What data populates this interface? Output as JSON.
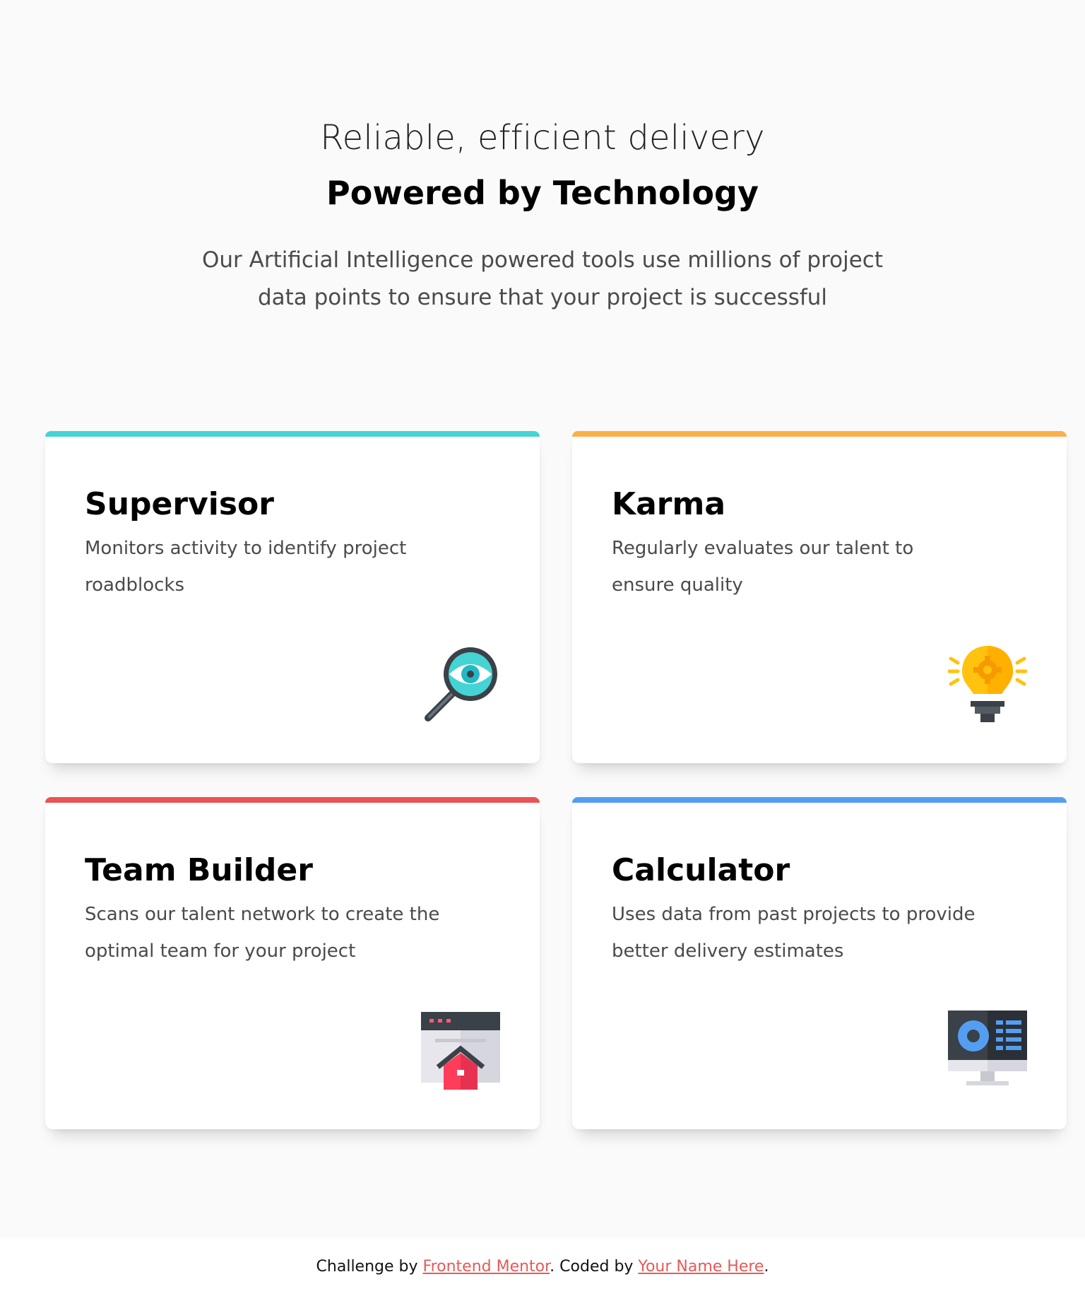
{
  "hero": {
    "subtitle": "Reliable, efficient delivery",
    "title": "Powered by Technology",
    "description": "Our Artificial Intelligence powered tools use millions of project data points to ensure that your project is successful"
  },
  "cards": [
    {
      "title": "Supervisor",
      "description": "Monitors activity to identify project roadblocks",
      "accent": "#45d3d3",
      "icon": "magnifier-eye-icon"
    },
    {
      "title": "Karma",
      "description": "Regularly evaluates our talent to ensure quality",
      "accent": "#fcae4a",
      "icon": "lightbulb-gear-icon"
    },
    {
      "title": "Team Builder",
      "description": "Scans our talent network to create the optimal team for your project",
      "accent": "#ea5454",
      "icon": "browser-house-icon"
    },
    {
      "title": "Calculator",
      "description": "Uses data from past projects to provide better delivery estimates",
      "accent": "#549ef2",
      "icon": "monitor-dashboard-icon"
    }
  ],
  "footer": {
    "prefix": "Challenge by ",
    "link1": "Frontend Mentor",
    "middle": ". Coded by ",
    "link2": "Your Name Here",
    "suffix": "."
  }
}
